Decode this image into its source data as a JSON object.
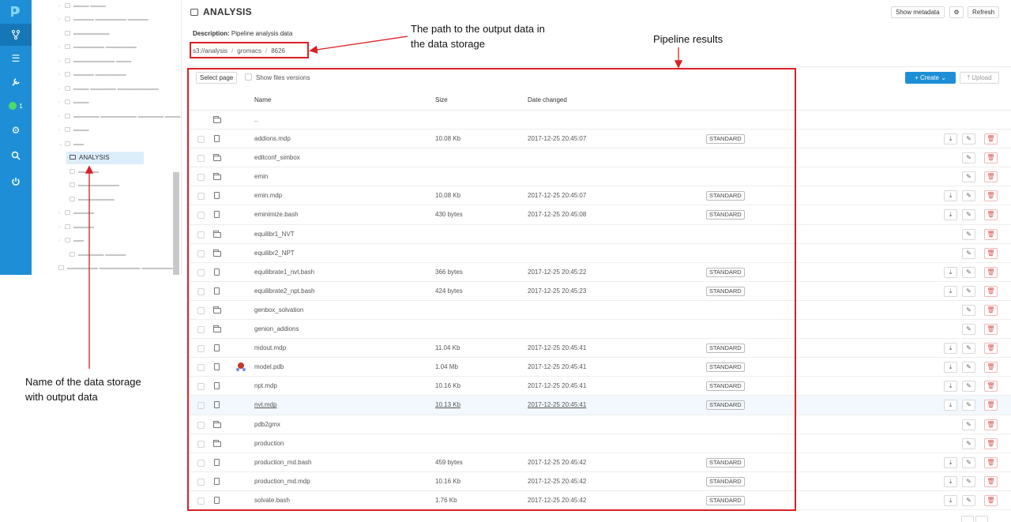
{
  "tree": {
    "selected_label": "ANALYSIS"
  },
  "header": {
    "title": "ANALYSIS",
    "show_metadata": "Show metadata",
    "settings_icon": "gear-icon",
    "refresh": "Refresh",
    "description_label": "Description:",
    "description_text": "Pipeline analysis data",
    "path": [
      "s3://analysis",
      "gromacs",
      "8626"
    ],
    "path_sep": "/"
  },
  "toolbar": {
    "select_page": "Select page",
    "show_versions": "Show files versions",
    "create": "Create",
    "upload": "Upload"
  },
  "table": {
    "columns": [
      "Name",
      "Size",
      "Date changed"
    ],
    "rows": [
      {
        "type": "folder",
        "name": "..",
        "size": "",
        "date": "",
        "class": "",
        "download": false,
        "edit": false,
        "del": false
      },
      {
        "type": "file",
        "name": "addions.mdp",
        "size": "10.08 Kb",
        "date": "2017-12-25 20:45:07",
        "class": "STANDARD",
        "download": true,
        "edit": true,
        "del": true
      },
      {
        "type": "folder",
        "name": "editconf_simbox",
        "size": "",
        "date": "",
        "class": "",
        "download": false,
        "edit": true,
        "del": true
      },
      {
        "type": "folder",
        "name": "emin",
        "size": "",
        "date": "",
        "class": "",
        "download": false,
        "edit": true,
        "del": true
      },
      {
        "type": "file",
        "name": "emin.mdp",
        "size": "10.08 Kb",
        "date": "2017-12-25 20:45:07",
        "class": "STANDARD",
        "download": true,
        "edit": true,
        "del": true
      },
      {
        "type": "file",
        "name": "eminimize.bash",
        "size": "430 bytes",
        "date": "2017-12-25 20:45:08",
        "class": "STANDARD",
        "download": true,
        "edit": true,
        "del": true
      },
      {
        "type": "folder",
        "name": "equilibr1_NVT",
        "size": "",
        "date": "",
        "class": "",
        "download": false,
        "edit": true,
        "del": true
      },
      {
        "type": "folder",
        "name": "equilibr2_NPT",
        "size": "",
        "date": "",
        "class": "",
        "download": false,
        "edit": true,
        "del": true
      },
      {
        "type": "file",
        "name": "equilibrate1_nvt.bash",
        "size": "366 bytes",
        "date": "2017-12-25 20:45:22",
        "class": "STANDARD",
        "download": true,
        "edit": true,
        "del": true
      },
      {
        "type": "file",
        "name": "equilibrate2_npt.bash",
        "size": "424 bytes",
        "date": "2017-12-25 20:45:23",
        "class": "STANDARD",
        "download": true,
        "edit": true,
        "del": true
      },
      {
        "type": "folder",
        "name": "genbox_solvation",
        "size": "",
        "date": "",
        "class": "",
        "download": false,
        "edit": true,
        "del": true
      },
      {
        "type": "folder",
        "name": "genion_addions",
        "size": "",
        "date": "",
        "class": "",
        "download": false,
        "edit": true,
        "del": true
      },
      {
        "type": "file",
        "name": "mdout.mdp",
        "size": "11.04 Kb",
        "date": "2017-12-25 20:45:41",
        "class": "STANDARD",
        "download": true,
        "edit": true,
        "del": true
      },
      {
        "type": "file",
        "name": "model.pdb",
        "size": "1.04 Mb",
        "date": "2017-12-25 20:45:41",
        "class": "STANDARD",
        "download": true,
        "edit": true,
        "del": true,
        "molecule": true
      },
      {
        "type": "file",
        "name": "npt.mdp",
        "size": "10.16 Kb",
        "date": "2017-12-25 20:45:41",
        "class": "STANDARD",
        "download": true,
        "edit": true,
        "del": true
      },
      {
        "type": "file",
        "name": "nvt.mdp",
        "size": "10.13 Kb",
        "date": "2017-12-25 20:45:41",
        "class": "STANDARD",
        "download": true,
        "edit": true,
        "del": true,
        "highlight": true
      },
      {
        "type": "folder",
        "name": "pdb2gmx",
        "size": "",
        "date": "",
        "class": "",
        "download": false,
        "edit": true,
        "del": true
      },
      {
        "type": "folder",
        "name": "production",
        "size": "",
        "date": "",
        "class": "",
        "download": false,
        "edit": true,
        "del": true
      },
      {
        "type": "file",
        "name": "production_md.bash",
        "size": "459 bytes",
        "date": "2017-12-25 20:45:42",
        "class": "STANDARD",
        "download": true,
        "edit": true,
        "del": true
      },
      {
        "type": "file",
        "name": "production_md.mdp",
        "size": "10.16 Kb",
        "date": "2017-12-25 20:45:42",
        "class": "STANDARD",
        "download": true,
        "edit": true,
        "del": true
      },
      {
        "type": "file",
        "name": "solvate.bash",
        "size": "1.76 Kb",
        "date": "2017-12-25 20:45:42",
        "class": "STANDARD",
        "download": true,
        "edit": true,
        "del": true
      }
    ]
  },
  "annotations": {
    "path_note_line1": "The path to the output  data in",
    "path_note_line2": "the data storage",
    "results_note": "Pipeline results",
    "storage_note_line1": "Name of the data storage",
    "storage_note_line2": "with output data",
    "color": "#dc1f26"
  },
  "colors": {
    "nav": "#1e8fd6",
    "accent": "#1e8fd6",
    "danger": "#e05555"
  }
}
